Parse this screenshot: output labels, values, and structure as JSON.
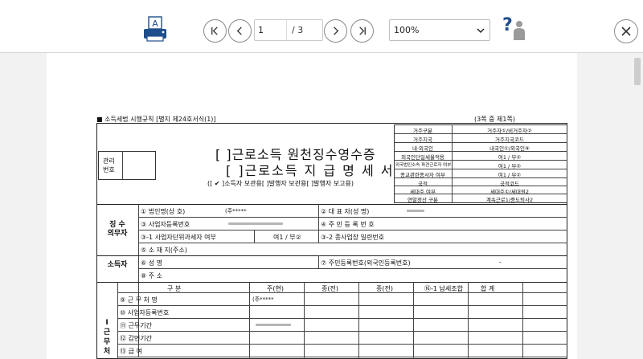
{
  "toolbar": {
    "page_current": "1",
    "page_total": "/ 3",
    "zoom_value": "100%",
    "icons": {
      "print": "print-icon",
      "first": "first-page-icon",
      "prev": "prev-page-icon",
      "next": "next-page-icon",
      "last": "last-page-icon",
      "help": "help-icon",
      "close": "close-icon"
    }
  },
  "document": {
    "header_left": "■ 소득세법 시행규칙 [별지 제24호서식(1)]",
    "header_right": "(3쪽 중 제1쪽)",
    "mgmt_label_1": "관리",
    "mgmt_label_2": "번호",
    "title_line_1": "[ ]근로소득 원천징수영수증",
    "title_line_2": "[ ]근로소득 지 급 명 세 서",
    "title_line_3": "([ ✔ ]소득자 보관용[     ]발행자 보관용[     ]발행자 보고용)",
    "residency": [
      {
        "label": "거주구분",
        "value": "거주자①/비거주자②"
      },
      {
        "label": "거주지국",
        "value": "거주지국코드"
      },
      {
        "label": "내·외국인",
        "value": "내국인①/외국인⑨"
      },
      {
        "label": "외국인단일세율적용",
        "value": "여1 / 부②"
      },
      {
        "label": "외국법인소속 파견근로자 여부",
        "value": "여1 / 부②"
      },
      {
        "label": "종교관련종사자 여부",
        "value": "여1 / 부②"
      },
      {
        "label": "국적",
        "value": "국적코드"
      },
      {
        "label": "세대주 여부",
        "value": "세대주①/세대원2"
      },
      {
        "label": "연말정산 구분",
        "value": "계속근로1/중도퇴사2"
      }
    ],
    "payer": {
      "section": "징 수\n의무자",
      "row1_left": "① 법인명(상 호)",
      "row1_left_value": "(주*****",
      "row1_right": "② 대 표 자(성    명)",
      "row2_left": "③ 사업자등록번호",
      "row2_right": "④ 주 민 등 록 번 호",
      "row3_left": "③-1 사업자단위과세자 여부",
      "row3_mid": "여1 / 부②",
      "row3_right": "③-2 종사업장 일련번호",
      "row4": "⑤ 소 재 지(주소)"
    },
    "income_earner": {
      "section": "소득자",
      "row1_left": "⑥ 성       명",
      "row1_right": "⑦ 주민등록번호(외국인등록번호)",
      "row1_right_value": "-",
      "row2": "⑧ 주        소"
    },
    "work": {
      "section": "Ⅰ\n근\n무\n처",
      "columns": [
        "구 분",
        "주(현)",
        "종(전)",
        "종(전)",
        "⑯-1 납세조합",
        "합 계"
      ],
      "rows": [
        {
          "label": "⑨ 근 무 처 명",
          "cur": "(주*****"
        },
        {
          "label": "⑩ 사업자등록번호",
          "cur": ""
        },
        {
          "label": "⑪ 근무기간",
          "cur": ""
        },
        {
          "label": "⑫ 감면기간",
          "cur": ""
        },
        {
          "label": "⑬ 급      여",
          "cur": ""
        }
      ]
    }
  }
}
